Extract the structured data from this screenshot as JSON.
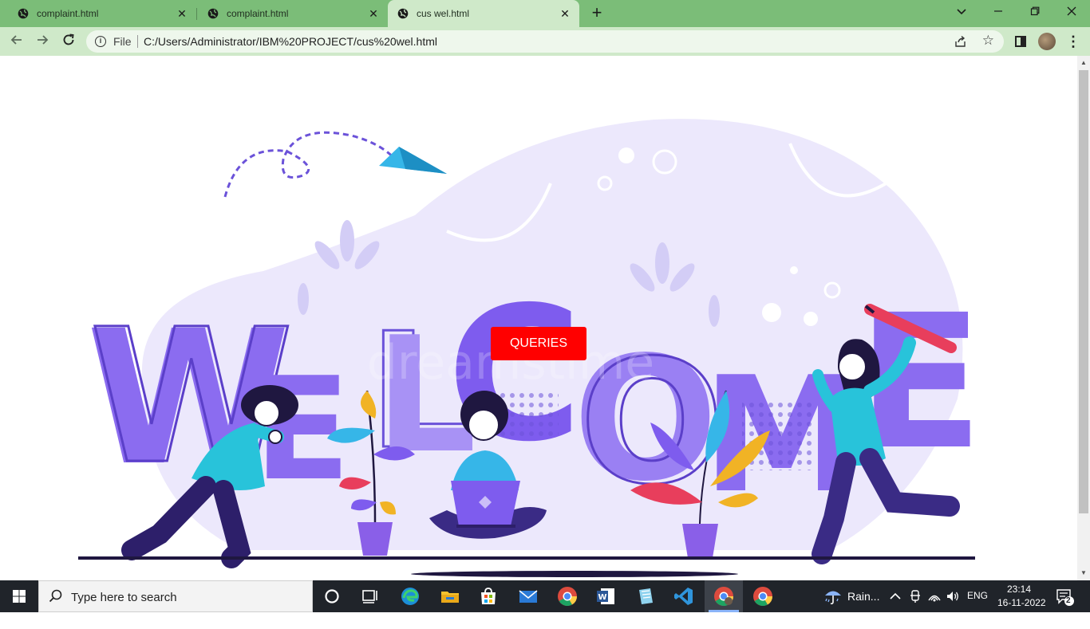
{
  "browser": {
    "tabs": [
      {
        "title": "complaint.html",
        "active": false
      },
      {
        "title": "complaint.html",
        "active": false
      },
      {
        "title": "cus wel.html",
        "active": true
      }
    ],
    "new_tab_label": "+",
    "file_label": "File",
    "url": "C:/Users/Administrator/IBM%20PROJECT/cus%20wel.html",
    "tab_color": "#7bbd78",
    "toolbar_color": "#cfe9c9"
  },
  "page": {
    "queries_button": "QUERIES",
    "hero_word": "WELCOME",
    "watermark": "dreamstime"
  },
  "taskbar": {
    "search_placeholder": "Type here to search",
    "weather": "Rain...",
    "language": "ENG",
    "time": "23:14",
    "date": "16-11-2022",
    "notification_count": "2"
  }
}
